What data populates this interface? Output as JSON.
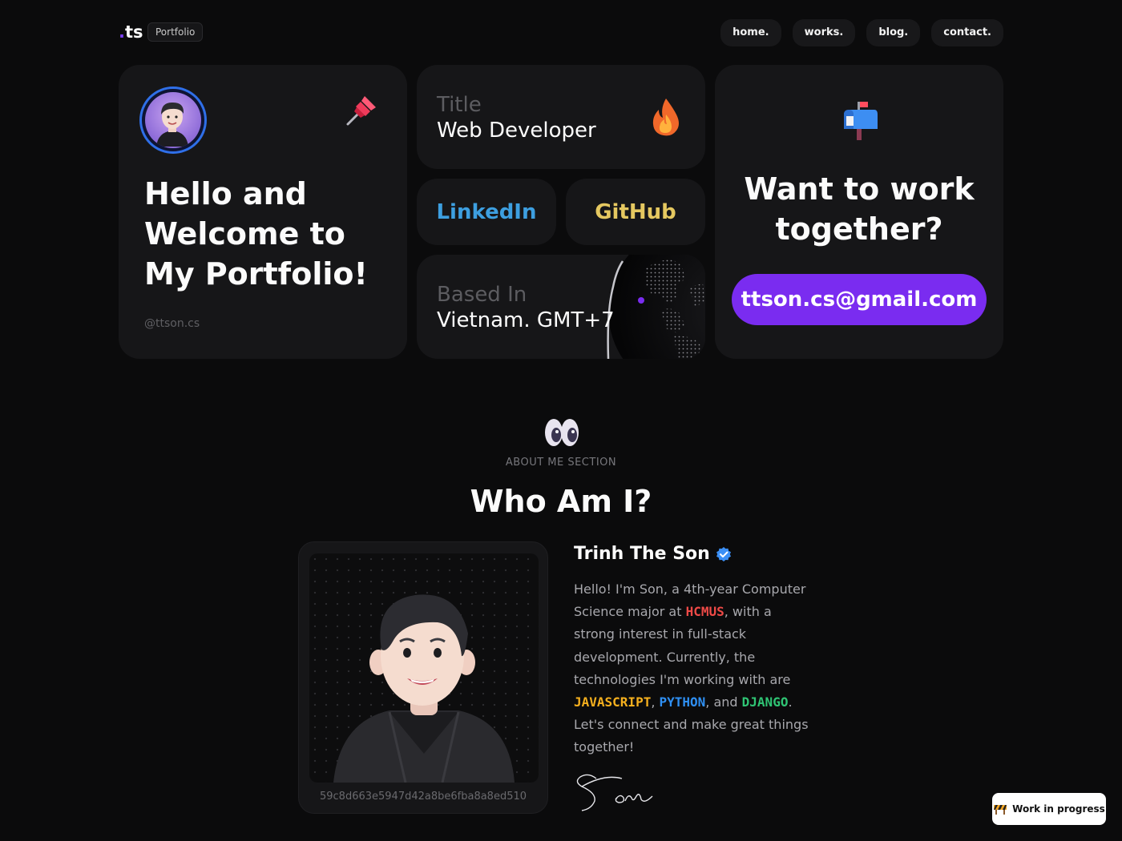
{
  "header": {
    "logo": "ts",
    "badge": "Portfolio",
    "nav": [
      "home.",
      "works.",
      "blog.",
      "contact."
    ]
  },
  "hero": {
    "title": "Hello and Welcome to My Portfolio!",
    "handle": "@ttson.cs",
    "icons": [
      "avatar",
      "pushpin-icon"
    ]
  },
  "title_card": {
    "label": "Title",
    "value": "Web Developer",
    "icon": "fire-icon"
  },
  "social": {
    "linkedin": "LinkedIn",
    "github": "GitHub"
  },
  "location": {
    "label": "Based In",
    "value": "Vietnam. GMT+7",
    "icon": "globe-icon"
  },
  "contact": {
    "title": "Want to work together?",
    "email": "ttson.cs@gmail.com",
    "icon": "mailbox-icon"
  },
  "about": {
    "section_label": "ABOUT ME SECTION",
    "title": "Who Am I?",
    "name": "Trinh The Son",
    "photo_hash": "59c8d663e5947d42a8be6fba8a8ed510",
    "bio": {
      "p1": "Hello! I'm Son, a 4th-year Computer Science major at ",
      "hcmus": "HCMUS",
      "p2": ", with a strong interest in full-stack development. Currently, the technologies I'm working with are ",
      "js": "JAVASCRIPT",
      "sep1": ", ",
      "python": "PYTHON",
      "sep2": ", and ",
      "django": "DJANGO",
      "p3": ". Let's connect and make great things together!"
    }
  },
  "status_badge": {
    "label": "Work in progress",
    "icon": "construction-icon"
  },
  "colors": {
    "accent": "#7a2cf0",
    "linkedin": "#3d9fe0",
    "github": "#e5c860",
    "hcmus": "#ef4a47",
    "javascript": "#f6b01e",
    "python": "#2f8ff2",
    "django": "#2fc474"
  }
}
